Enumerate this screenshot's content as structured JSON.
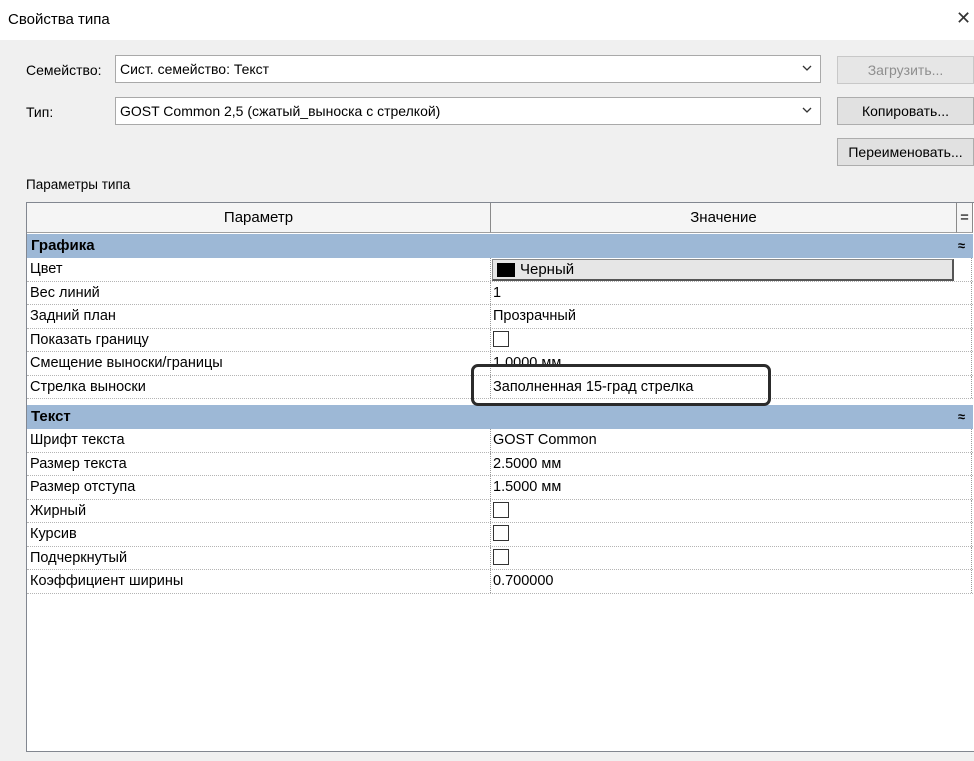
{
  "window": {
    "title": "Свойства типа",
    "close_glyph": "✕"
  },
  "family": {
    "label": "Семейство:",
    "value": "Сист. семейство: Текст"
  },
  "type": {
    "label": "Тип:",
    "value": "GOST Common 2,5 (сжатый_выноска с стрелкой)"
  },
  "buttons": {
    "load": "Загрузить...",
    "copy": "Копировать...",
    "rename": "Переименовать..."
  },
  "section_label": "Параметры типа",
  "grid": {
    "header": {
      "param": "Параметр",
      "value": "Значение",
      "sort": "="
    },
    "groups": [
      {
        "name": "Графика",
        "caret": "≈",
        "rows": [
          {
            "param": "Цвет",
            "value": "Черный",
            "kind": "color",
            "swatch": "#000000"
          },
          {
            "param": "Вес линий",
            "value": "1",
            "kind": "text"
          },
          {
            "param": "Задний план",
            "value": "Прозрачный",
            "kind": "text"
          },
          {
            "param": "Показать границу",
            "value": "",
            "kind": "checkbox",
            "checked": false
          },
          {
            "param": "Смещение выноски/границы",
            "value": "1.0000 мм",
            "kind": "text"
          },
          {
            "param": "Стрелка выноски",
            "value": "Заполненная 15-град стрелка",
            "kind": "text"
          }
        ]
      },
      {
        "name": "Текст",
        "caret": "≈",
        "rows": [
          {
            "param": "Шрифт текста",
            "value": "GOST Common",
            "kind": "text"
          },
          {
            "param": "Размер текста",
            "value": "2.5000 мм",
            "kind": "text"
          },
          {
            "param": "Размер отступа",
            "value": "1.5000 мм",
            "kind": "text"
          },
          {
            "param": "Жирный",
            "value": "",
            "kind": "checkbox",
            "checked": false
          },
          {
            "param": "Курсив",
            "value": "",
            "kind": "checkbox",
            "checked": false
          },
          {
            "param": "Подчеркнутый",
            "value": "",
            "kind": "checkbox",
            "checked": false
          },
          {
            "param": "Коэффициент ширины",
            "value": "0.700000",
            "kind": "text"
          }
        ]
      }
    ]
  }
}
